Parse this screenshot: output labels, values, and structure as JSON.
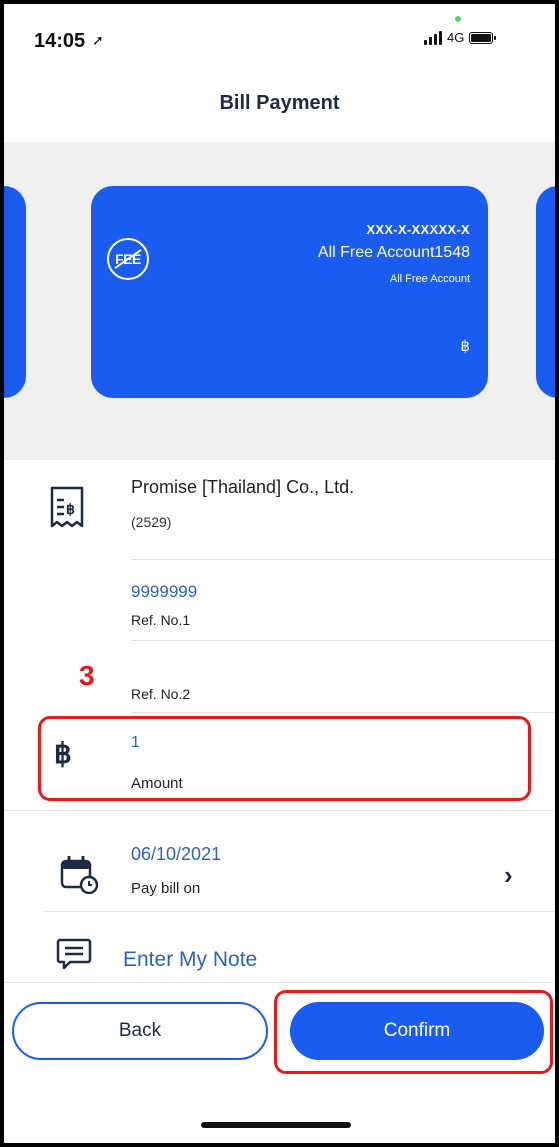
{
  "status_bar": {
    "time": "14:05",
    "network": "4G"
  },
  "header": {
    "title": "Bill Payment"
  },
  "account_card": {
    "account_number": "XXX-X-XXXXX-X",
    "account_name": "All Free Account1548",
    "account_type": "All Free Account",
    "currency_symbol": "฿",
    "icon_label": "FEE"
  },
  "biller": {
    "name": "Promise [Thailand] Co., Ltd.",
    "code": "(2529)"
  },
  "ref1": {
    "value": "9999999",
    "label": "Ref. No.1"
  },
  "ref2": {
    "label": "Ref. No.2"
  },
  "annotation": {
    "step": "3",
    "highlight_color": "#e51b1b"
  },
  "amount": {
    "symbol": "฿",
    "value": "1",
    "label": "Amount"
  },
  "pay_date": {
    "value": "06/10/2021",
    "label": "Pay bill on"
  },
  "note": {
    "label": "Enter My Note"
  },
  "buttons": {
    "back": "Back",
    "confirm": "Confirm"
  },
  "colors": {
    "brand": "#1a5cf0",
    "value_text": "#2d62c5",
    "dark": "#1f2a44"
  }
}
